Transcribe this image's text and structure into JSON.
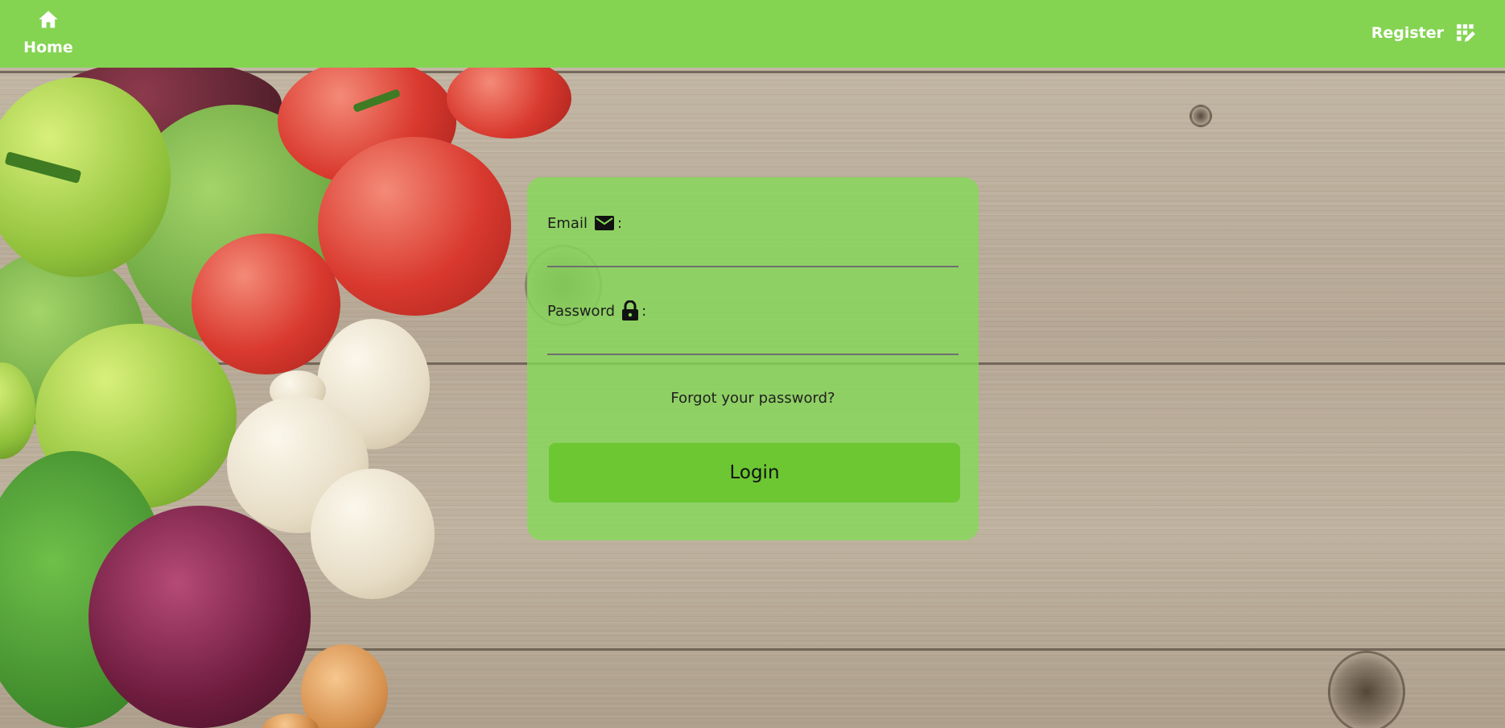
{
  "navbar": {
    "home_label": "Home",
    "home_icon": "home-icon",
    "register_label": "Register",
    "register_icon": "register-icon",
    "background_color": "#84d452"
  },
  "login_form": {
    "email_label": "Email",
    "email_icon": "envelope-icon",
    "email_value": "",
    "password_label": "Password",
    "password_icon": "lock-icon",
    "password_value": "",
    "colon": ":",
    "forgot_password": "Forgot your password?",
    "login_button": "Login",
    "card_color": "#84da58",
    "button_color": "#6cc733"
  }
}
